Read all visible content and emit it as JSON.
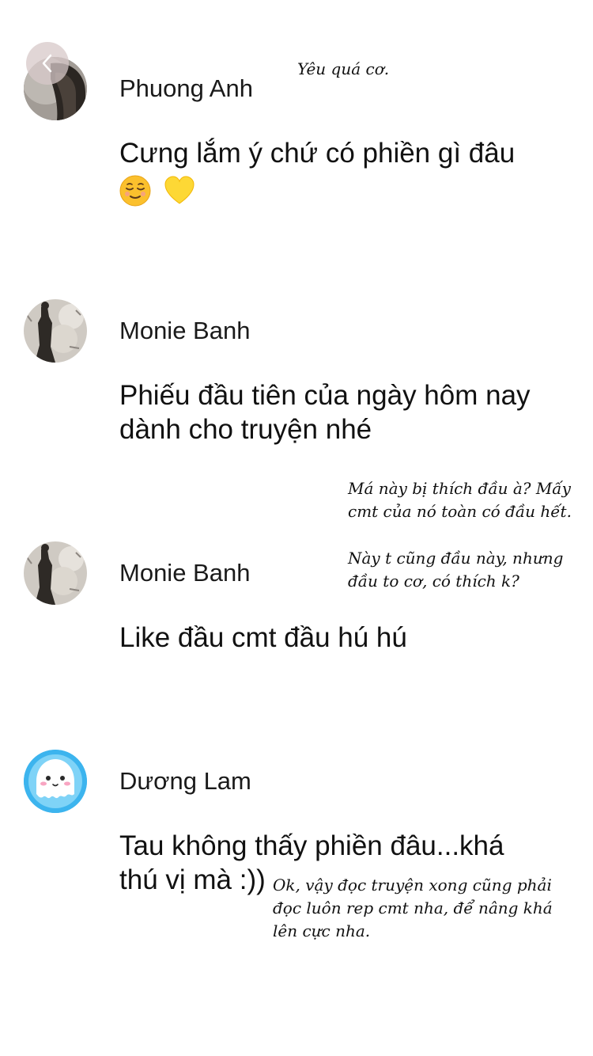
{
  "nav": {
    "back_icon": "chevron-left-icon"
  },
  "comments": [
    {
      "author": "Phuong Anh",
      "text": "Cưng lắm ý chứ có phiền gì đâu",
      "emojis": [
        "relieved-face-icon",
        "yellow-heart-icon"
      ]
    },
    {
      "author": "Monie Banh",
      "text_lines": [
        "Phiếu đầu tiên của ngày hôm nay",
        "dành cho truyện nhé"
      ]
    },
    {
      "author": "Monie Banh",
      "text": "Like đầu cmt đầu hú hú"
    },
    {
      "author": "Dương Lam",
      "text_lines": [
        "Tau không thấy phiền đâu...khá",
        "thú vị mà :))"
      ]
    }
  ],
  "notes": {
    "note1": [
      "Yêu quá cơ."
    ],
    "note2": [
      "Má này bị thích đầu à? Mấy",
      "cmt của nó toàn có đầu hết."
    ],
    "note3": [
      "Này t cũng đầu này, nhưng",
      "đầu to cơ, có thích k?"
    ],
    "note4": [
      "Ok, vậy đọc truyện xong cũng phải",
      "đọc luôn rep cmt nha, để nâng khá",
      "lên cực nha."
    ]
  },
  "colors": {
    "background": "#ffffff",
    "text": "#111111",
    "duong_lam_avatar": "#3cb4ee"
  }
}
